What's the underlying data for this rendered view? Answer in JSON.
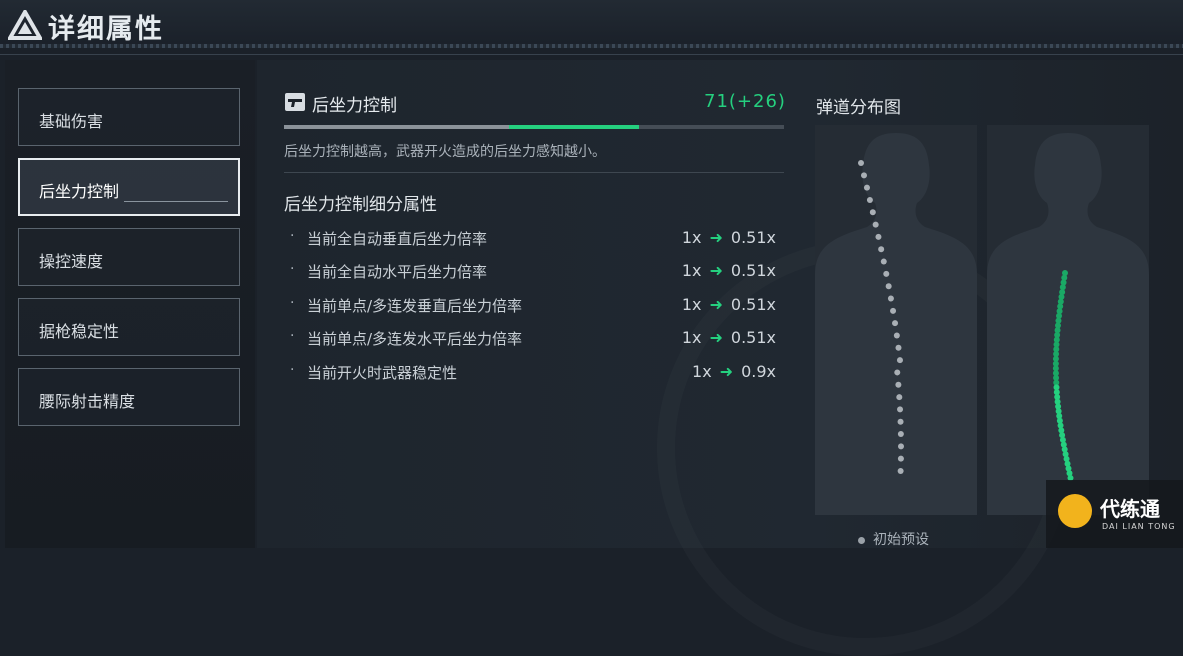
{
  "header": {
    "title": "详细属性"
  },
  "nav": {
    "items": [
      {
        "label": "基础伤害"
      },
      {
        "label": "后坐力控制",
        "active": true
      },
      {
        "label": "操控速度"
      },
      {
        "label": "据枪稳定性"
      },
      {
        "label": "腰际射击精度"
      }
    ]
  },
  "stat": {
    "name": "后坐力控制",
    "value": "71(+26)",
    "base_fraction": 0.45,
    "bonus_fraction": 0.26,
    "description": "后坐力控制越高，武器开火造成的后坐力感知越小。",
    "icon": "pistol-icon"
  },
  "details": {
    "title": "后坐力控制细分属性",
    "rows": [
      {
        "name": "当前全自动垂直后坐力倍率",
        "from": "1x",
        "to": "0.51x"
      },
      {
        "name": "当前全自动水平后坐力倍率",
        "from": "1x",
        "to": "0.51x"
      },
      {
        "name": "当前单点/多连发垂直后坐力倍率",
        "from": "1x",
        "to": "0.51x"
      },
      {
        "name": "当前单点/多连发水平后坐力倍率",
        "from": "1x",
        "to": "0.51x"
      },
      {
        "name": "当前开火时武器稳定性",
        "from": "1x",
        "to": "0.9x"
      }
    ],
    "arrow_icon": "arrow-right-icon"
  },
  "ballistics": {
    "title": "弹道分布图",
    "legend_label": "初始预设"
  },
  "watermark": {
    "title": "代练通",
    "subtitle": "DAI LIAN TONG"
  },
  "colors": {
    "accent": "#25d07f",
    "text": "#d7dde3",
    "background": "#1b2129"
  }
}
